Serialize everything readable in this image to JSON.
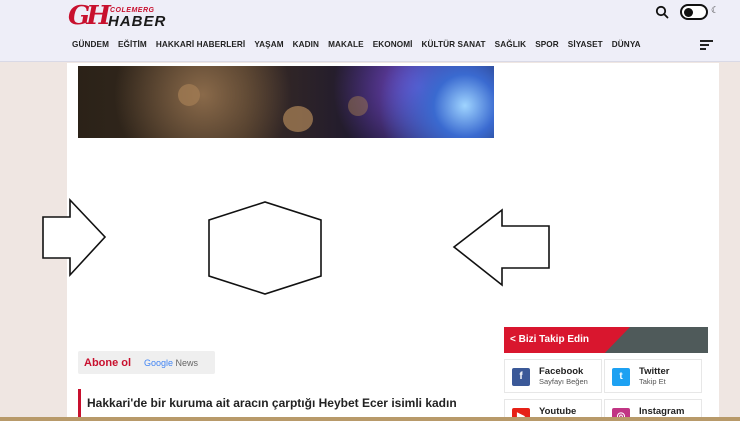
{
  "header": {
    "logo": {
      "mark": "GH",
      "top_text": "COLEMERG",
      "bottom_text": "HABER"
    },
    "search_icon": "search-icon",
    "theme_icon": "moon-icon",
    "menu_icon": "hamburger-icon"
  },
  "nav": {
    "items": [
      "GÜNDEM",
      "EĞİTİM",
      "HAKKARİ HABERLERİ",
      "YAŞAM",
      "KADIN",
      "MAKALE",
      "EKONOMİ",
      "KÜLTÜR SANAT",
      "SAĞLIK",
      "SPOR",
      "SİYASET",
      "DÜNYA"
    ]
  },
  "subscribe": {
    "label": "Abone ol",
    "google": "Google",
    "news": "News"
  },
  "headline": {
    "text": "Hakkari'de bir kuruma ait aracın çarptığı Heybet Ecer isimli kadın"
  },
  "follow": {
    "title": "Bizi Takip Edin",
    "share_icon": "share-icon",
    "cards": [
      {
        "name": "Facebook",
        "sub": "Sayfayı Beğen",
        "icon": "f",
        "color": "#3b5998"
      },
      {
        "name": "Twitter",
        "sub": "Takip Et",
        "icon": "t",
        "color": "#1da1f2"
      },
      {
        "name": "Youtube",
        "sub": "",
        "icon": "▶",
        "color": "#e62117"
      },
      {
        "name": "Instagram",
        "sub": "",
        "icon": "◎",
        "color": "#c13584"
      }
    ]
  },
  "colors": {
    "accent": "#c8102e",
    "header_bg": "#eeeef8",
    "page_bg": "#efe6e2"
  }
}
